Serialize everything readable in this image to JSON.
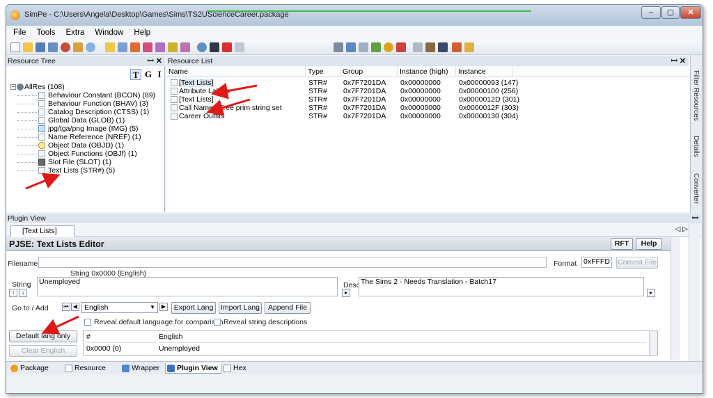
{
  "window": {
    "title": "SimPe - C:\\Users\\Angela\\Desktop\\Games\\Sims\\TS2UScienceCareer.package",
    "buttons": {
      "minimize": "–",
      "maximize": "▢",
      "close": "✕"
    }
  },
  "menu": [
    "File",
    "Tools",
    "Extra",
    "Window",
    "Help"
  ],
  "resource_tree": {
    "title": "Resource Tree",
    "tgi": [
      "T",
      "G",
      "I"
    ],
    "root": "AllRes (108)",
    "items": [
      "Behaviour Constant (BCON) (89)",
      "Behaviour Function (BHAV) (3)",
      "Catalog Description (CTSS) (1)",
      "Global Data (GLOB) (1)",
      "jpg/tga/png Image (IMG) (5)",
      "Name Reference (NREF) (1)",
      "Object Data (OBJD) (1)",
      "Object Functions (OBJf) (1)",
      "Slot File (SLOT) (1)",
      "Text Lists (STR#) (5)"
    ]
  },
  "resource_list": {
    "title": "Resource List",
    "columns": [
      "Name",
      "Type",
      "Group",
      "Instance (high)",
      "Instance"
    ],
    "rows": [
      {
        "name": "[Text Lists]",
        "type": "STR#",
        "group": "0x7F7201DA",
        "inst_high": "0x00000000",
        "instance": "0x00000093 (147)"
      },
      {
        "name": "Attribute Labels",
        "type": "STR#",
        "group": "0x7F7201DA",
        "inst_high": "0x00000000",
        "instance": "0x00000100 (256)"
      },
      {
        "name": "[Text Lists]",
        "type": "STR#",
        "group": "0x7F7201DA",
        "inst_high": "0x00000000",
        "instance": "0x0000012D (301)"
      },
      {
        "name": "Call Named Tree prim string set",
        "type": "STR#",
        "group": "0x7F7201DA",
        "inst_high": "0x00000000",
        "instance": "0x0000012F (303)"
      },
      {
        "name": "Career Outfits",
        "type": "STR#",
        "group": "0x7F7201DA",
        "inst_high": "0x00000000",
        "instance": "0x00000130 (304)"
      }
    ]
  },
  "side_tabs": [
    "Filter Resources",
    "Details",
    "Converter"
  ],
  "plugin_view": {
    "title": "Plugin View",
    "tab": "[Text Lists]",
    "editor_title": "PJSE: Text Lists Editor",
    "rft_label": "RFT",
    "help_label": "Help",
    "filename_label": "Filename",
    "filename_value": "",
    "format_label": "Format",
    "format_value": "0xFFFD",
    "commit_label": "Commit File",
    "string_header": "String 0x0000 (English)",
    "string_label": "String",
    "string_value": "Unemployed",
    "desc_label": "Desc",
    "desc_value": "The Sims 2 - Needs Translation - Batch17",
    "goto_label": "Go to / Add",
    "language": "English",
    "export_label": "Export Lang",
    "import_label": "Import Lang",
    "append_label": "Append File",
    "reveal_default_label": "Reveal default language for comparison",
    "reveal_desc_label": "Reveal string descriptions",
    "default_lang_label": "Default lang only",
    "clear_label": "Clear English",
    "grid_columns": [
      "#",
      "English"
    ],
    "grid_rows": [
      {
        "num": "0x0000 (0)",
        "value": "Unemployed"
      }
    ]
  },
  "bottom_tabs": [
    "Package",
    "Resource",
    "Wrapper",
    "Plugin View",
    "Hex"
  ],
  "colors": {
    "annotation_arrow": "#e01818",
    "selection": "#dde8f6"
  }
}
